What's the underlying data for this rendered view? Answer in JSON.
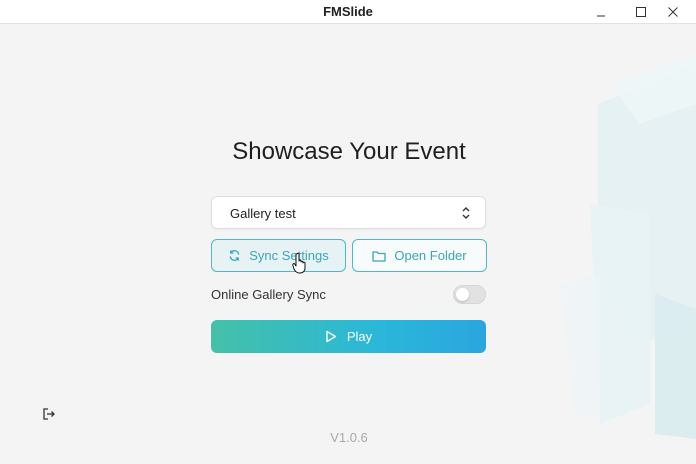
{
  "window": {
    "title": "FMSlide",
    "controls": [
      "minimize-icon",
      "maximize-icon",
      "close-icon"
    ]
  },
  "main": {
    "headline": "Showcase Your Event",
    "gallery_select": {
      "value": "Gallery test",
      "icon": "chevron-updown-icon"
    },
    "buttons": {
      "sync_settings": {
        "label": "Sync Settings",
        "icon": "refresh-icon"
      },
      "open_folder": {
        "label": "Open Folder",
        "icon": "folder-icon"
      },
      "play": {
        "label": "Play",
        "icon": "play-icon"
      }
    },
    "online_gallery_sync": {
      "label": "Online Gallery Sync",
      "enabled": false
    }
  },
  "footer": {
    "version": "V1.0.6",
    "logout_icon": "logout-icon"
  },
  "colors": {
    "accent": "#3aa6b6",
    "play_gradient_start": "#45c0a8",
    "play_gradient_end": "#2aa6de",
    "background": "#f4f4f4"
  }
}
